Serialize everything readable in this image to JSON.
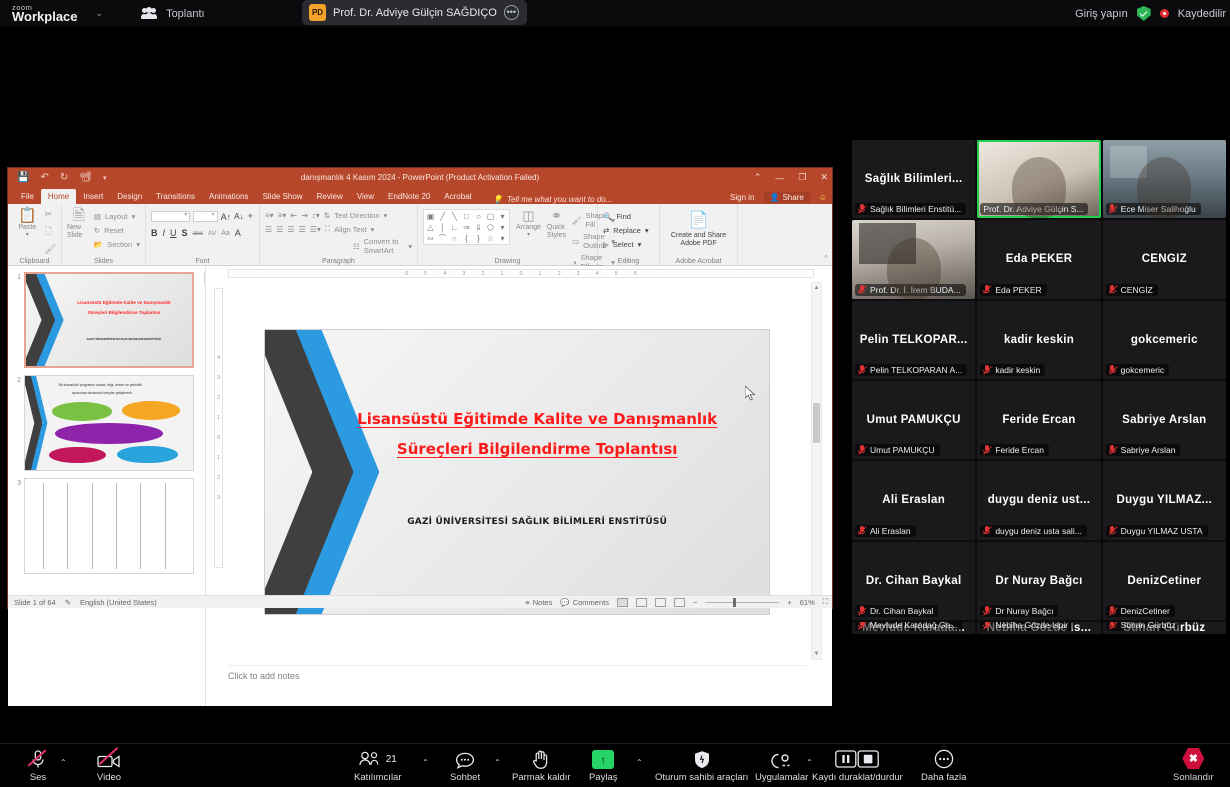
{
  "zoom_topbar": {
    "logo_small": "zoom",
    "logo_big": "Workplace",
    "caret": "⌄",
    "meeting_label": "Toplantı",
    "active_tab": {
      "initials": "PD",
      "title": "Prof. Dr. Adviye Gülçin SAĞDIÇO",
      "more": "•••"
    },
    "sign_in": "Giriş yapın",
    "recording_label": "Kaydedilir"
  },
  "powerpoint": {
    "title": "danışmanlık 4 Kasım 2024 - PowerPoint (Product Activation Failed)",
    "quick_access": [
      "save-icon",
      "undo-icon",
      "redo-icon",
      "present-icon",
      "more-icon"
    ],
    "window_buttons": [
      "ribbon-display-icon",
      "minimize",
      "restore",
      "close"
    ],
    "minimize": "—",
    "restore": "❐",
    "close": "✕",
    "ribbon_display": "⌃",
    "tabs": [
      "File",
      "Home",
      "Insert",
      "Design",
      "Transitions",
      "Animations",
      "Slide Show",
      "Review",
      "View",
      "EndNote 20",
      "Acrobat"
    ],
    "active_tab": "Home",
    "tell_me": "Tell me what you want to do...",
    "sign_in": "Sign in",
    "share": "Share",
    "ribbon": {
      "clipboard": {
        "label": "Clipboard",
        "paste": "Paste",
        "items": [
          "cut-icon",
          "copy-icon",
          "format-painter-icon"
        ]
      },
      "slides": {
        "label": "Slides",
        "new_slide": "New Slide",
        "layout": "Layout",
        "reset": "Reset",
        "section": "Section"
      },
      "font": {
        "label": "Font",
        "font_name": "",
        "font_size": "",
        "grow": "A",
        "shrink": "A",
        "clear": "✦",
        "bold": "B",
        "italic": "I",
        "underline": "U",
        "shadow": "S",
        "strike": "abc",
        "spacing": "AV",
        "case": "Aa",
        "color": "A"
      },
      "paragraph": {
        "label": "Paragraph",
        "text_direction": "Text Direction",
        "align_text": "Align Text",
        "convert": "Convert to SmartArt"
      },
      "drawing": {
        "label": "Drawing",
        "arrange": "Arrange",
        "quick_styles": "Quick Styles",
        "shape_fill": "Shape Fill",
        "shape_outline": "Shape Outline",
        "shape_effects": "Shape Effects"
      },
      "editing": {
        "label": "Editing",
        "find": "Find",
        "replace": "Replace",
        "select": "Select"
      },
      "acrobat": {
        "label": "Adobe Acrobat",
        "create_share": "Create and Share Adobe PDF"
      }
    },
    "slide": {
      "title_line1": "Lisansüstü Eğitimde Kalite ve Danışmanlık",
      "title_line2": "Süreçleri Bilgilendirme Toplantısı",
      "subtitle": "GAZİ ÜNİVERSİTESİ SAĞLIK BİLİMLERİ ENSTİTÜSÜ",
      "title_color": "#ff1a1a"
    },
    "thumbnails": [
      {
        "number": "1",
        "selected": true
      },
      {
        "number": "2",
        "selected": false
      },
      {
        "number": "3",
        "selected": false
      }
    ],
    "notes_placeholder": "Click to add notes",
    "ruler_marks": [
      "6",
      "5",
      "4",
      "3",
      "2",
      "1",
      "0",
      "1",
      "2",
      "3",
      "4",
      "5",
      "6"
    ],
    "ruler_marks_v": [
      "4",
      "3",
      "2",
      "1",
      "0",
      "1",
      "2",
      "3"
    ],
    "status": {
      "slide_count": "Slide 1 of 64",
      "language": "English (United States)",
      "notes": "Notes",
      "comments": "Comments",
      "zoom_level": "61%"
    }
  },
  "gallery": {
    "participants": [
      {
        "big": "Sağlık  Bilimleri...",
        "bar": "Sağlık Bilimleri Enstitü...",
        "video": false,
        "active": false,
        "muted": true
      },
      {
        "big": "",
        "bar": "Prof. Dr. Adviye Gülçin S...",
        "video": "vid-b",
        "active": true,
        "muted": false
      },
      {
        "big": "",
        "bar": "Ece Miser Salihoğlu",
        "video": "vid-c",
        "active": false,
        "muted": true
      },
      {
        "big": "",
        "bar": "Prof. Dr. İ. İrem BUDA...",
        "video": "vid-a",
        "active": false,
        "muted": true
      },
      {
        "big": "Eda PEKER",
        "bar": "Eda PEKER",
        "video": false,
        "active": false,
        "muted": true
      },
      {
        "big": "CENGİZ",
        "bar": "CENGİZ",
        "video": false,
        "active": false,
        "muted": true
      },
      {
        "big": "Pelin  TELKOPAR...",
        "bar": "Pelin TELKOPARAN A...",
        "video": false,
        "active": false,
        "muted": true
      },
      {
        "big": "kadir keskin",
        "bar": "kadir keskin",
        "video": false,
        "active": false,
        "muted": true
      },
      {
        "big": "gokcemeric",
        "bar": "gokcemeric",
        "video": false,
        "active": false,
        "muted": true
      },
      {
        "big": "Umut PAMUKÇU",
        "bar": "Umut PAMUKÇU",
        "video": false,
        "active": false,
        "muted": true
      },
      {
        "big": "Feride Ercan",
        "bar": "Feride Ercan",
        "video": false,
        "active": false,
        "muted": true
      },
      {
        "big": "Sabriye Arslan",
        "bar": "Sabriye Arslan",
        "video": false,
        "active": false,
        "muted": true
      },
      {
        "big": "Ali Eraslan",
        "bar": "Ali Eraslan",
        "video": false,
        "active": false,
        "muted": true
      },
      {
        "big": "duygu  deniz  ust...",
        "bar": "duygu deniz usta sali...",
        "video": false,
        "active": false,
        "muted": true
      },
      {
        "big": "Duygu  YILMAZ...",
        "bar": "Duygu YILMAZ USTA",
        "video": false,
        "active": false,
        "muted": true
      },
      {
        "big": "Dr. Cihan Baykal",
        "bar": "Dr. Cihan Baykal",
        "video": false,
        "active": false,
        "muted": true
      },
      {
        "big": "Dr Nuray Bağcı",
        "bar": "Dr Nuray Bağcı",
        "video": false,
        "active": false,
        "muted": true
      },
      {
        "big": "DenizCetiner",
        "bar": "DenizCetiner",
        "video": false,
        "active": false,
        "muted": true
      },
      {
        "big": "Mevlude  Karada...",
        "bar": "Mevlude Karadağ Ga...",
        "video": false,
        "active": false,
        "muted": true
      },
      {
        "big": "Nebiha  Gözde  İs...",
        "bar": "Nebiha Gözde İspir",
        "video": false,
        "active": false,
        "muted": true
      },
      {
        "big": "Sühan Gürbüz",
        "bar": "Sühan Gürbüz",
        "video": false,
        "active": false,
        "muted": true
      }
    ]
  },
  "toolbar": {
    "audio": "Ses",
    "video": "Video",
    "participants": "Katılımcılar",
    "participants_count": "21",
    "chat": "Sohbet",
    "raise_hand": "Parmak kaldır",
    "share": "Paylaş",
    "host_tools": "Oturum sahibi araçları",
    "apps": "Uygulamalar",
    "record": "Kaydı duraklat/durdur",
    "more": "Daha fazla",
    "end": "Sonlandır",
    "caret": "⌃",
    "end_color": "#d0103c",
    "share_color": "#26d367"
  }
}
